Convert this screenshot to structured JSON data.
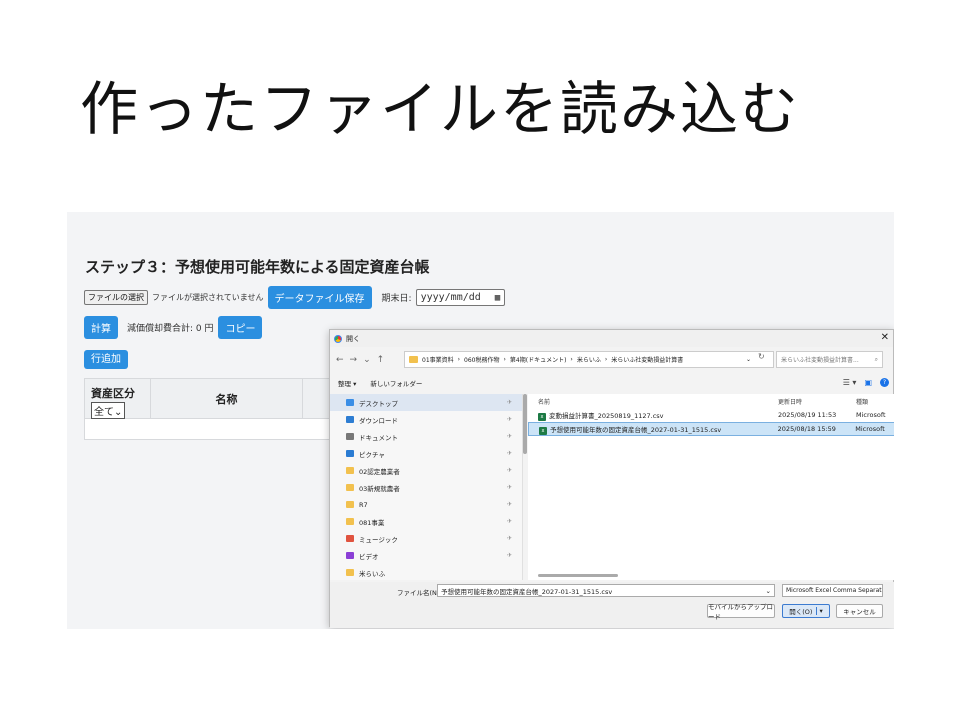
{
  "slide": {
    "title": "作ったファイルを読み込む"
  },
  "app": {
    "step_title": "ステップ３：予想使用可能年数による固定資産台帳",
    "file_button": "ファイルの選択",
    "file_status": "ファイルが選択されていません",
    "save_button": "データファイル保存",
    "period_label": "期末日:",
    "date_placeholder": "yyyy/mm/dd",
    "calc_button": "計算",
    "depreciation_label": "減価償却費合計: 0 円",
    "copy_button": "コピー",
    "add_row_button": "行追加",
    "table": {
      "col_asset_class": "資産区分",
      "filter_value": "全て",
      "col_name": "名称"
    }
  },
  "dialog": {
    "title": "開く",
    "path": [
      "01事業資料",
      "060税務作物",
      "第4期(ドキュメント)",
      "米らいふ",
      "米らいふ社変動損益計算書"
    ],
    "search_placeholder": "米らいふ社変動損益計算書...",
    "toolbar": {
      "organize": "整理 ▾",
      "new_folder": "新しいフォルダー"
    },
    "nav_items": [
      {
        "label": "デスクトップ",
        "color": "#3a8ee6"
      },
      {
        "label": "ダウンロード",
        "color": "#2d7dd2"
      },
      {
        "label": "ドキュメント",
        "color": "#777777"
      },
      {
        "label": "ピクチャ",
        "color": "#2b7cd3"
      },
      {
        "label": "02認定農業者",
        "color": "#f2c14e"
      },
      {
        "label": "03新規就農者",
        "color": "#f2c14e"
      },
      {
        "label": "R7",
        "color": "#f2c14e"
      },
      {
        "label": "081事業",
        "color": "#f2c14e"
      },
      {
        "label": "ミュージック",
        "color": "#e0533f"
      },
      {
        "label": "ビデオ",
        "color": "#8b3fd6"
      },
      {
        "label": "米らいふ",
        "color": "#f2c14e"
      }
    ],
    "columns": {
      "name": "名前",
      "modified": "更新日時",
      "type": "種類"
    },
    "files": [
      {
        "name": "変動損益計算書_20250819_1127.csv",
        "modified": "2025/08/19 11:53",
        "type": "Microsoft"
      },
      {
        "name": "予想使用可能年数の固定資産台帳_2027-01-31_1515.csv",
        "modified": "2025/08/18 15:59",
        "type": "Microsoft"
      }
    ],
    "filename_label": "ファイル名(N):",
    "filename_value": "予想使用可能年数の固定資産台帳_2027-01-31_1515.csv",
    "filetype": "Microsoft Excel Comma Separat",
    "upload_button": "モバイルからアップロード",
    "open_button": "開く(O)",
    "cancel_button": "キャンセル"
  }
}
